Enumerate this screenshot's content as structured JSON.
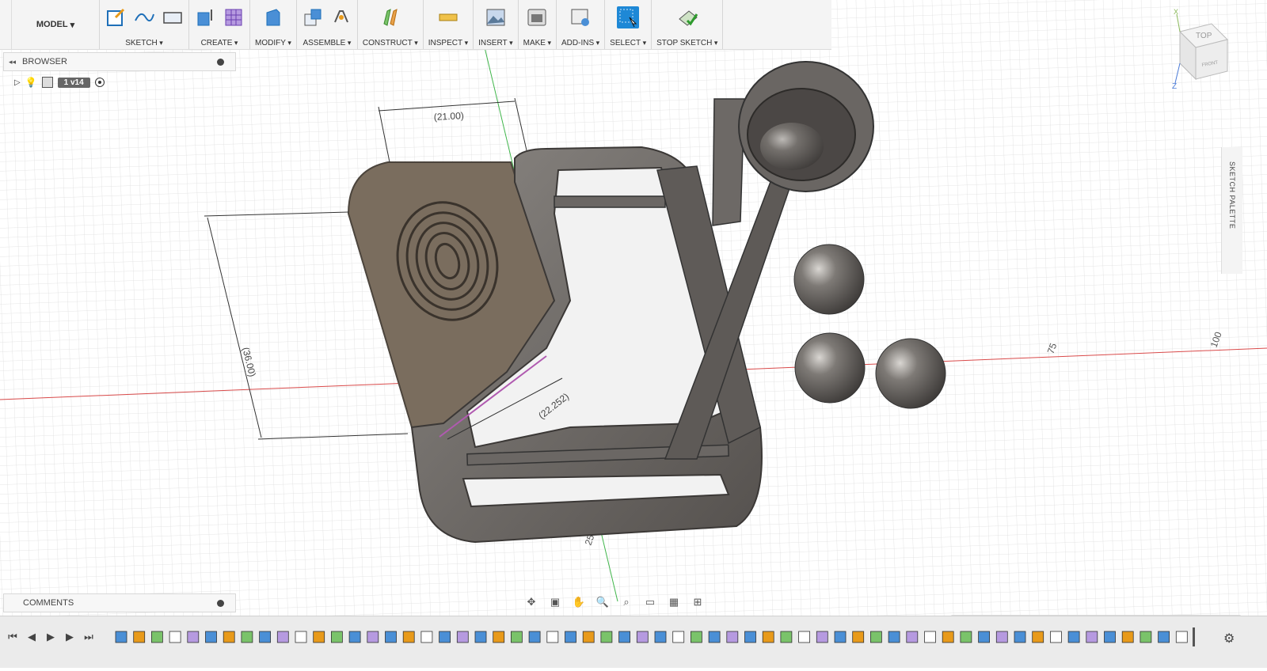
{
  "toolbar": {
    "workspace": "MODEL",
    "groups": [
      {
        "label": "SKETCH"
      },
      {
        "label": "CREATE"
      },
      {
        "label": "MODIFY"
      },
      {
        "label": "ASSEMBLE"
      },
      {
        "label": "CONSTRUCT"
      },
      {
        "label": "INSPECT"
      },
      {
        "label": "INSERT"
      },
      {
        "label": "MAKE"
      },
      {
        "label": "ADD-INS"
      },
      {
        "label": "SELECT"
      },
      {
        "label": "STOP SKETCH"
      }
    ]
  },
  "browser": {
    "title": "BROWSER",
    "component": "1 v14"
  },
  "comments": {
    "title": "COMMENTS"
  },
  "view_cube": {
    "top": "TOP",
    "front": "FRONT",
    "axis_x": "X",
    "axis_z": "Z"
  },
  "sketch_palette": {
    "label": "SKETCH PALETTE"
  },
  "dimensions": {
    "width": "(21.00)",
    "height": "(36.00)",
    "diagonal": "(22.252)"
  },
  "grid_labels": {
    "x75": "75",
    "x100": "100",
    "y25": "25"
  },
  "colors": {
    "accent": "#1e88d6",
    "model_gray": "#6e6a66",
    "plate_brown": "#7a6d5e",
    "grid": "#d8d8d8",
    "axis_red": "#d94a4a",
    "axis_green": "#3fb54a"
  },
  "timeline": {
    "feature_count": 60
  }
}
